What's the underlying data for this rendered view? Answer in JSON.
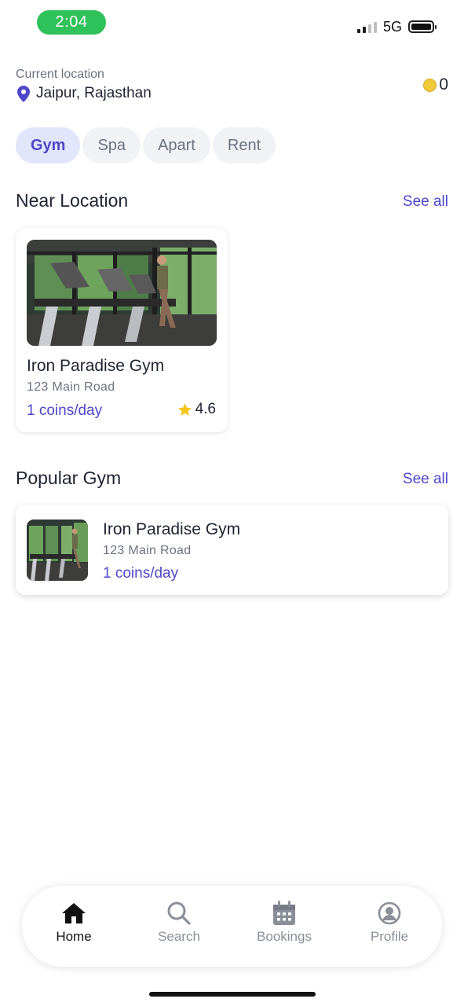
{
  "status_bar": {
    "time": "2:04",
    "network": "5G"
  },
  "header": {
    "location_label": "Current location",
    "location_city": "Jaipur, Rajasthan",
    "coin_count": "0"
  },
  "tabs": [
    {
      "label": "Gym",
      "active": true
    },
    {
      "label": "Spa",
      "active": false
    },
    {
      "label": "Apart",
      "active": false
    },
    {
      "label": "Rent",
      "active": false
    }
  ],
  "near_section": {
    "title": "Near Location",
    "see_all": "See all",
    "card": {
      "name": "Iron Paradise Gym",
      "address": "123 Main Road",
      "price": "1 coins/day",
      "rating": "4.6"
    }
  },
  "popular_section": {
    "title": "Popular Gym",
    "see_all": "See all",
    "card": {
      "name": "Iron Paradise Gym",
      "address": "123 Main Road",
      "price": "1 coins/day"
    }
  },
  "bottom_nav": [
    {
      "label": "Home",
      "icon": "home-icon",
      "active": true
    },
    {
      "label": "Search",
      "icon": "search-icon",
      "active": false
    },
    {
      "label": "Bookings",
      "icon": "calendar-icon",
      "active": false
    },
    {
      "label": "Profile",
      "icon": "profile-icon",
      "active": false
    }
  ],
  "colors": {
    "accent": "#4f46c9",
    "status_green": "#2fc15a",
    "coin": "#f0c93a",
    "star": "#f5c518"
  }
}
